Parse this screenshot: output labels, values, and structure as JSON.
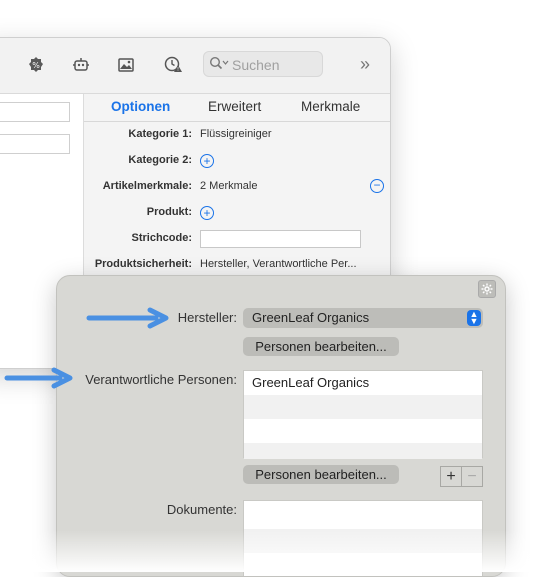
{
  "toolbar": {
    "search_placeholder": "Suchen",
    "overflow": "»",
    "icons": [
      "badge-icon",
      "robot-icon",
      "image-icon",
      "clock-alert-icon",
      "search-icon"
    ]
  },
  "tabs": [
    {
      "label": "Optionen",
      "active": true
    },
    {
      "label": "Erweitert",
      "active": false
    },
    {
      "label": "Merkmale",
      "active": false
    }
  ],
  "fields": {
    "kategorie1": {
      "label": "Kategorie 1:",
      "value": "Flüssigreiniger"
    },
    "kategorie2": {
      "label": "Kategorie 2:"
    },
    "artikelmerkmale": {
      "label": "Artikelmerkmale:",
      "value": "2 Merkmale"
    },
    "produkt": {
      "label": "Produkt:"
    },
    "strichcode": {
      "label": "Strichcode:",
      "value": ""
    },
    "produktsicherheit": {
      "label": "Produktsicherheit:",
      "value": "Hersteller, Verantwortliche Per..."
    }
  },
  "popover": {
    "hersteller_label": "Hersteller:",
    "hersteller_value": "GreenLeaf Organics",
    "edit_persons_label": "Personen bearbeiten...",
    "responsible_label": "Verantwortliche Personen:",
    "responsible_list": [
      "GreenLeaf Organics",
      "",
      "",
      ""
    ],
    "edit_persons_label_2": "Personen bearbeiten...",
    "add_symbol": "+",
    "remove_symbol": "−",
    "documents_label": "Dokumente:"
  },
  "colors": {
    "accent": "#1a73e8",
    "arrow": "#4a90e2"
  }
}
